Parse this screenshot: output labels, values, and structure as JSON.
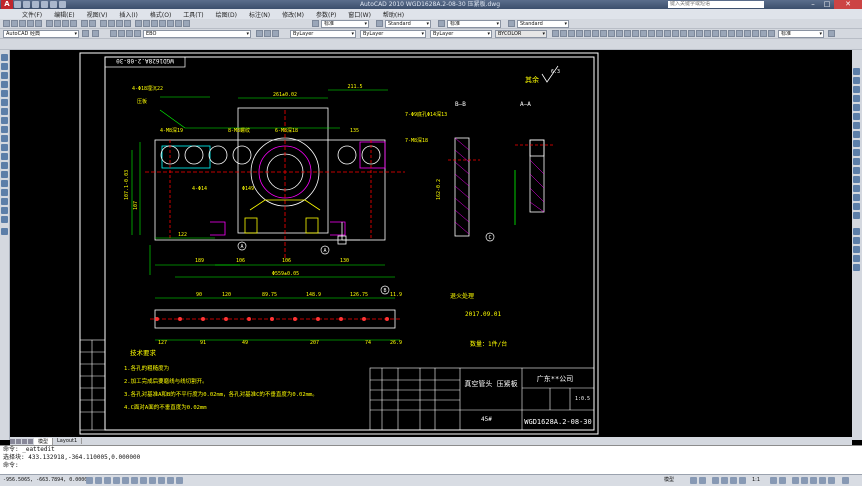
{
  "app": {
    "title": "AutoCAD 2010   WGD1628A.2-08-30 压紧板.dwg",
    "search_placeholder": "键入关键字或短语"
  },
  "menu": [
    "文件(F)",
    "编辑(E)",
    "视图(V)",
    "插入(I)",
    "格式(O)",
    "工具(T)",
    "绘图(D)",
    "标注(N)",
    "修改(M)",
    "参数(P)",
    "窗口(W)",
    "帮助(H)"
  ],
  "toolbar_styles": {
    "text_style": "标准",
    "dim_style": "Standard",
    "table_style": "标准",
    "mleader_style": "Standard"
  },
  "toolbar_layers": {
    "workspace": "AutoCAD 经典",
    "layer": "EBO",
    "color": "ByLayer",
    "linetype": "ByLayer",
    "lineweight": "ByLayer",
    "plotstyle": "BYCOLOR",
    "right_style": "标准"
  },
  "drawing": {
    "part_number_rotated": "WGD1628A.2-08-30",
    "other_roughness_label": "其余",
    "other_roughness_value": "6.3",
    "section_b": "B—B",
    "section_a": "A—A",
    "top_dims": [
      "211.5",
      "261±0.02",
      "135"
    ],
    "notes_left": [
      "4-Φ18埋沉22",
      "压板",
      "4-Φ14",
      "4-M8深19",
      "8-M8螺纹",
      "6-M8深18"
    ],
    "notes_top": [
      "7-Φ9底孔Φ14深13",
      "7-M8深18",
      "Φ149"
    ],
    "side_dims": [
      "107.1-0.03",
      "107",
      "162-0.2"
    ],
    "bottom_dims_a": [
      "122",
      "189",
      "106",
      "106",
      "130"
    ],
    "bottom_dim_total": "Φ559±0.05",
    "strip_dims_top": [
      "90",
      "120",
      "89.75",
      "148.9",
      "126.75",
      "11.9"
    ],
    "strip_dims_bottom": [
      "127",
      "91",
      "49",
      "207",
      "74",
      "26.9"
    ],
    "heat_treatment": "退火处理",
    "date": "2017.09.01",
    "quantity": "数量：1件/台",
    "tech_title": "技术要求",
    "tech_notes": [
      "1.各孔的粗糙度为",
      "2.加工完成后要磨线与线切割开。",
      "3.各孔对基准A和B的不平行度为0.02mm，各孔对基准C的不垂直度为0.02mm。",
      "4.C面对A面的不垂直度为0.02mm"
    ],
    "company": "广东**公司",
    "part_name": "真空管头 压紧板",
    "drawing_no": "WGD1628A.2-08-30",
    "material": "45#",
    "scale": "1:0.5",
    "circle_labels": [
      "A",
      "C",
      "A",
      "B"
    ]
  },
  "layout_tabs": [
    "模型",
    "Layout1"
  ],
  "command_lines": [
    "命令: _eattedit",
    "选择块: 433.132918,-364.110005,0.000000",
    "命令:"
  ],
  "status": {
    "coordinates": "-956.5065, -663.7894, 0.0000",
    "model_label": "模型",
    "scale_label": "1:1"
  }
}
